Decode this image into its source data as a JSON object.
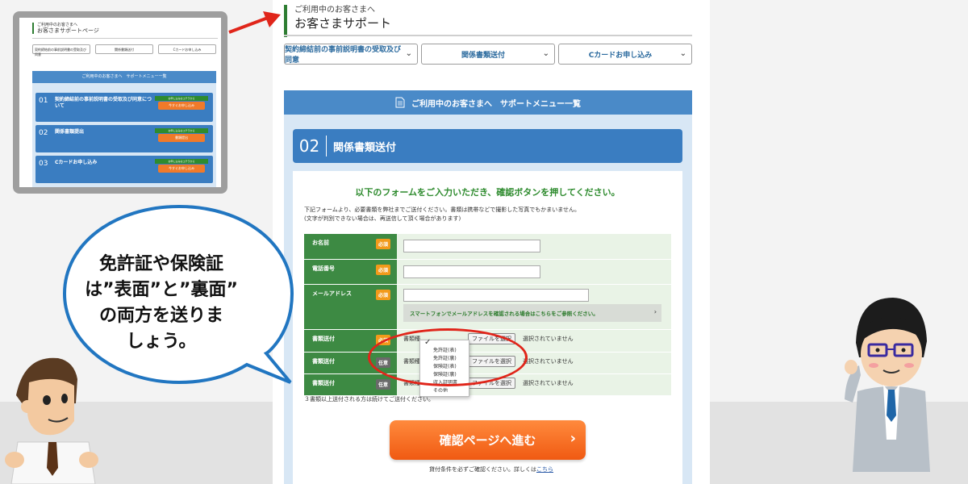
{
  "header": {
    "small": "ご利用中のお客さまへ",
    "title": "お客さまサポート"
  },
  "dropdowns": [
    {
      "label": "契約締結前の事前説明書の受取及び同意"
    },
    {
      "label": "関係書類送付"
    },
    {
      "label": "Cカードお申し込み"
    }
  ],
  "menu_band": "ご利用中のお客さまへ　サポートメニュー一覧",
  "section": {
    "num": "02",
    "title": "関係書類送付"
  },
  "form": {
    "lead": "以下のフォームをご入力いただき、確認ボタンを押してください。",
    "desc_line1": "下記フォームより、必要書類を弊社までご送付ください。書類は携帯などで撮影した写真でもかまいません。",
    "desc_line2": "(文字が判別できない場合は、再送信して頂く場合があります)",
    "required_tag": "必須",
    "optional_tag": "任意",
    "name_label": "お名前",
    "phone_label": "電話番号",
    "email_label": "メールアドレス",
    "sp_link": "スマートフォンでメールアドレスを確認される場合はこちらをご参照ください。",
    "doc_label": "書類送付",
    "doc_type": "書類種",
    "file_button": "ファイルを選択",
    "no_file": "選択されていません",
    "popup_options": [
      "免許証(表)",
      "免許証(裏)",
      "保険証(表)",
      "保険証(裏)",
      "収入証明書",
      "その他"
    ],
    "note": "３書類以上送付される方は続けてご送付ください。",
    "cta": "確認ページへ進む",
    "terms_prefix": "貸付条件を必ずご確認ください。詳しくは",
    "terms_link": "こちら"
  },
  "thumbnail": {
    "small": "ご利用中のお客さまへ",
    "title": "お客さまサポートページ",
    "dropdowns": [
      "契約締結前の事前説明書の受取及び同意",
      "関係書類送付",
      "Cカードお申し込み"
    ],
    "band": "ご利用中のお客さまへ　サポートメニュー一覧",
    "items": [
      {
        "num": "01",
        "title": "契約締結前の事前説明書の受取及び同意について",
        "green": "お申し込みはコチラから",
        "button": "今すぐお申し込み"
      },
      {
        "num": "02",
        "title": "関係書類提出",
        "green": "お申し込みはコチラから",
        "button": "書類提出"
      },
      {
        "num": "03",
        "title": "Cカードお申し込み",
        "green": "お申し込みはコチラから",
        "button": "今すぐお申し込み"
      }
    ]
  },
  "bubble": {
    "line1": "免許証や保険証",
    "line2": "は”表面”と”裏面”",
    "line3": "の両方を送りま",
    "line4": "しょう。"
  }
}
